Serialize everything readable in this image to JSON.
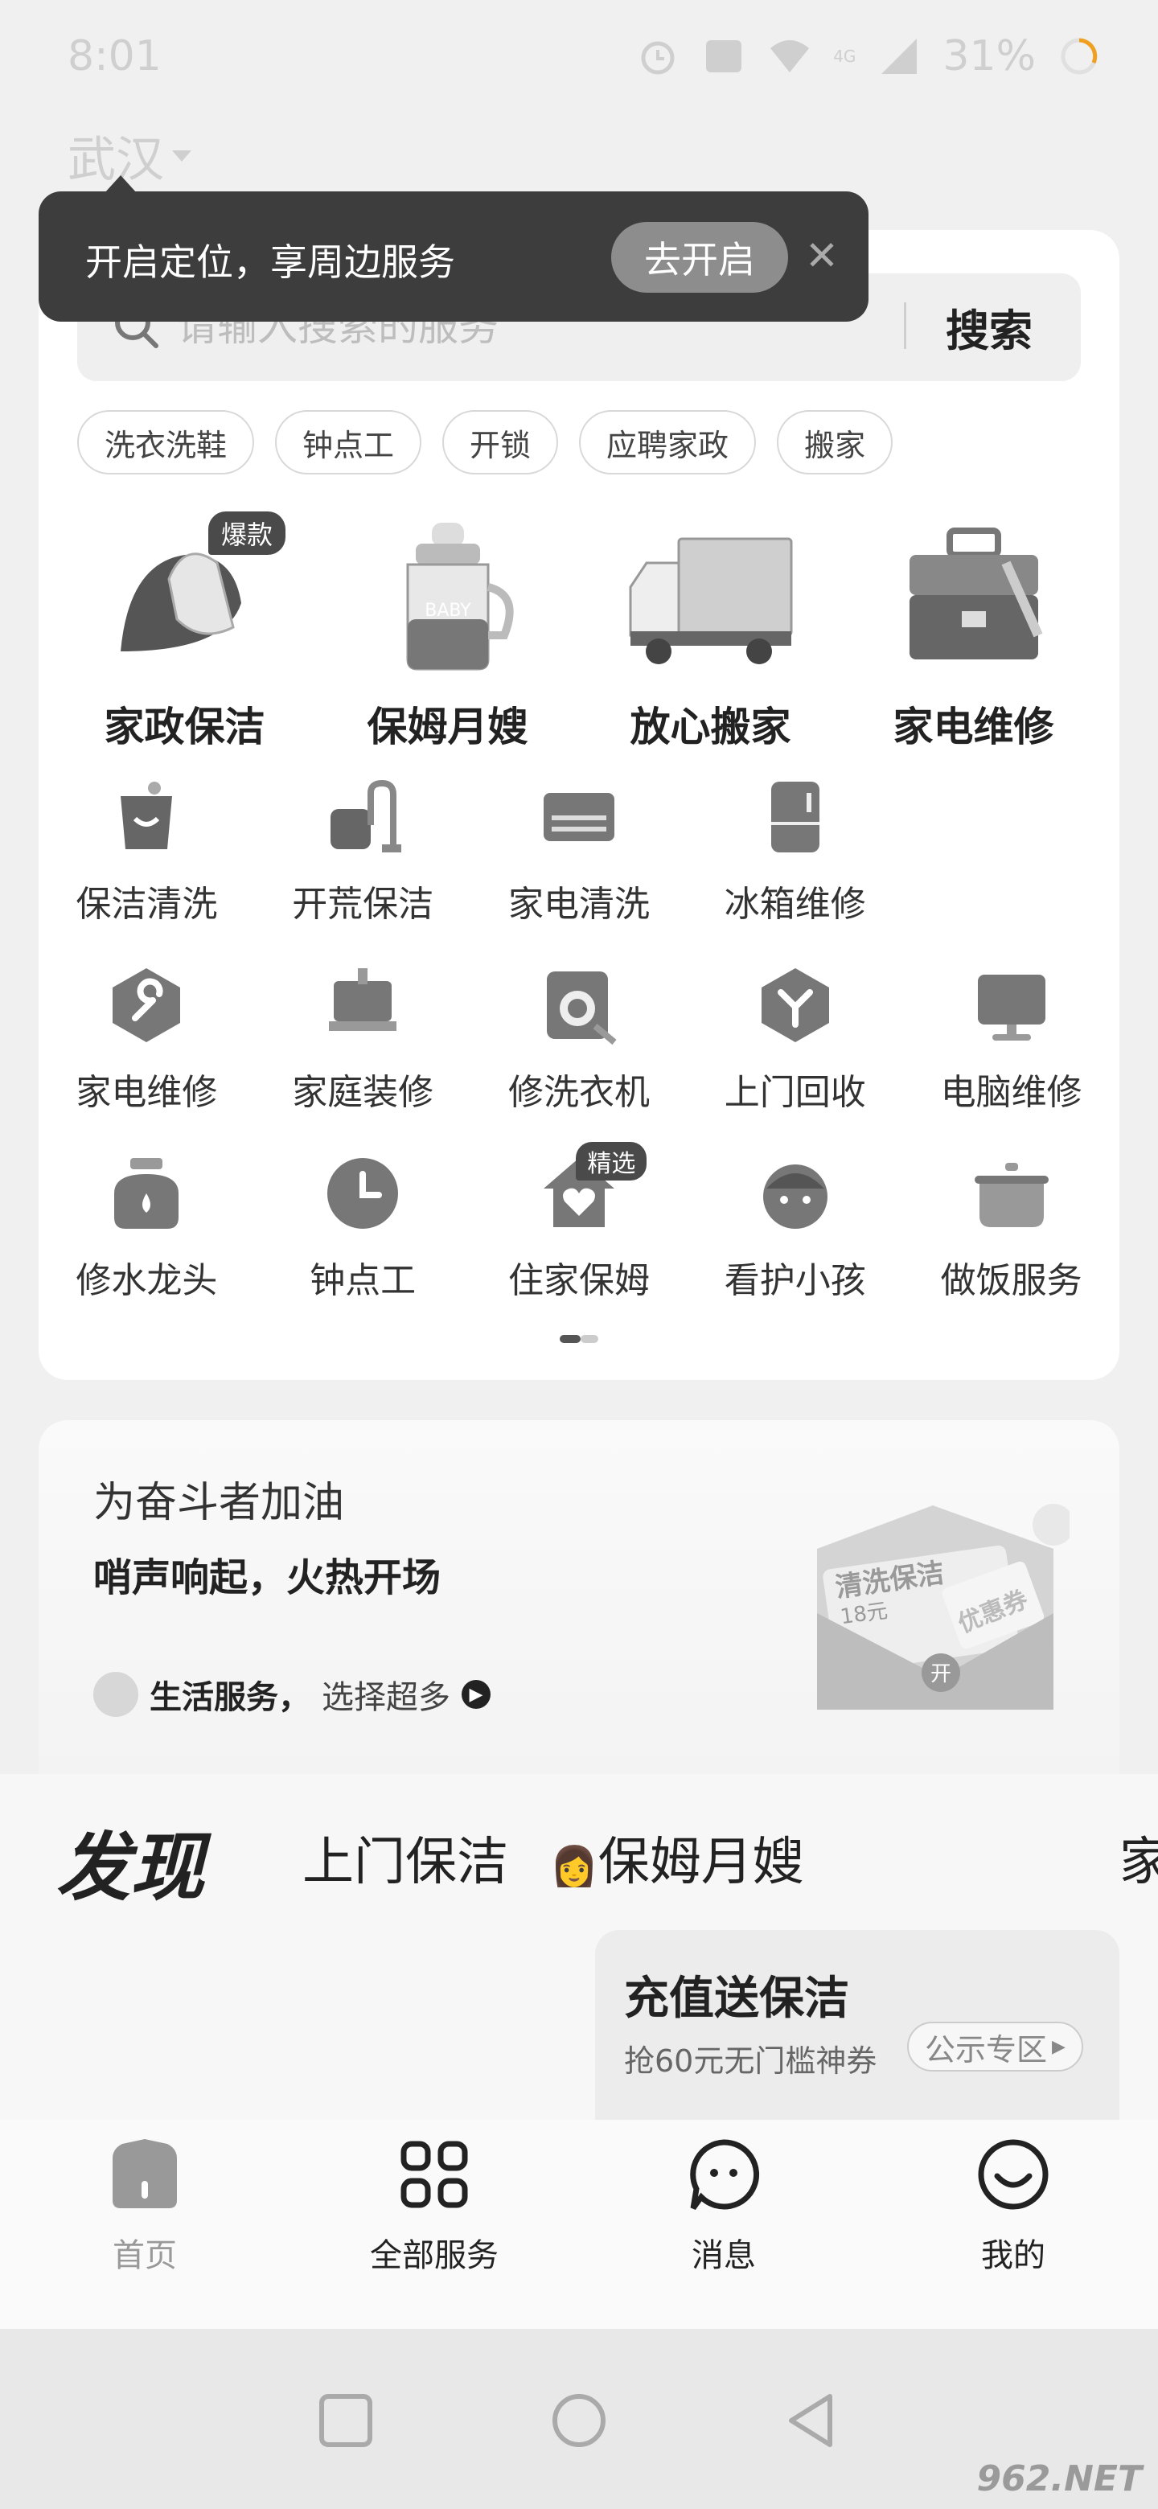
{
  "status_bar": {
    "time": "8:01",
    "battery": "31%",
    "network": "4G"
  },
  "location": {
    "city": "武汉"
  },
  "toast": {
    "text": "开启定位，享周边服务",
    "button": "去开启",
    "close_icon": "close-icon"
  },
  "search": {
    "placeholder": "请输入搜索的服务",
    "button": "搜索"
  },
  "quick_chips": [
    "洗衣洗鞋",
    "钟点工",
    "开锁",
    "应聘家政",
    "搬家"
  ],
  "big_categories": [
    {
      "label": "家政保洁",
      "badge": "爆款",
      "icon": "cleaning-cloth-icon"
    },
    {
      "label": "保姆月嫂",
      "badge": "",
      "icon": "baby-bottle-icon"
    },
    {
      "label": "放心搬家",
      "badge": "",
      "icon": "moving-truck-icon"
    },
    {
      "label": "家电维修",
      "badge": "",
      "icon": "toolbox-icon"
    }
  ],
  "small_categories": [
    {
      "label": "保洁清洗",
      "badge": "",
      "icon": "cleaning-bag-icon"
    },
    {
      "label": "开荒保洁",
      "badge": "",
      "icon": "vacuum-icon"
    },
    {
      "label": "家电清洗",
      "badge": "",
      "icon": "air-conditioner-icon"
    },
    {
      "label": "冰箱维修",
      "badge": "",
      "icon": "fridge-icon"
    },
    {
      "label": "",
      "badge": "",
      "icon": ""
    },
    {
      "label": "家电维修",
      "badge": "",
      "icon": "wrench-icon"
    },
    {
      "label": "家庭装修",
      "badge": "",
      "icon": "paint-roller-icon"
    },
    {
      "label": "修洗衣机",
      "badge": "",
      "icon": "washing-machine-icon"
    },
    {
      "label": "上门回收",
      "badge": "",
      "icon": "recycle-icon"
    },
    {
      "label": "电脑维修",
      "badge": "",
      "icon": "computer-icon"
    },
    {
      "label": "修水龙头",
      "badge": "",
      "icon": "faucet-icon"
    },
    {
      "label": "钟点工",
      "badge": "",
      "icon": "clock-icon"
    },
    {
      "label": "住家保姆",
      "badge": "精选",
      "icon": "house-heart-icon"
    },
    {
      "label": "看护小孩",
      "badge": "",
      "icon": "child-icon"
    },
    {
      "label": "做饭服务",
      "badge": "",
      "icon": "cooking-pot-icon"
    }
  ],
  "promo": {
    "title": "为奋斗者加油",
    "subtitle": "哨声响起，火热开场",
    "link_strong": "生活服务，",
    "link_rest": "选择超多",
    "coupon_title": "清洗保洁",
    "coupon_amount": "18元",
    "coupon_tag": "优惠券",
    "coupon_open": "开"
  },
  "discover": {
    "logo": "发现",
    "tabs": [
      "上门保洁",
      "保姆月嫂",
      "家"
    ],
    "card_title": "充值送保洁",
    "card_sub": "抢60元无门槛神券",
    "notice": "公示专区"
  },
  "tab_bar": [
    {
      "label": "首页",
      "icon": "home-icon",
      "active": true
    },
    {
      "label": "全部服务",
      "icon": "grid-icon",
      "active": false
    },
    {
      "label": "消息",
      "icon": "chat-bubble-icon",
      "active": false
    },
    {
      "label": "我的",
      "icon": "smiley-icon",
      "active": false
    }
  ],
  "watermark": "962.NET"
}
